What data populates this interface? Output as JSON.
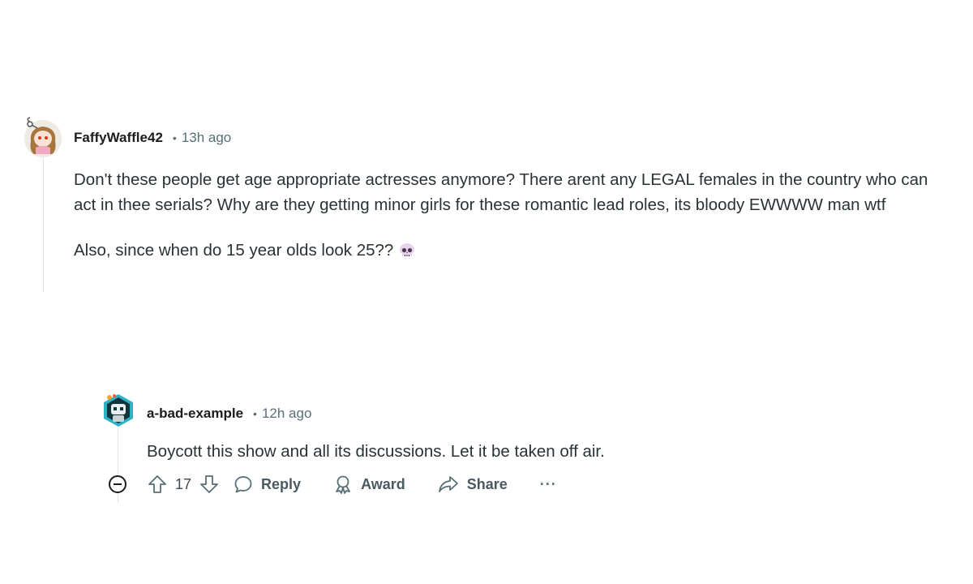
{
  "comment": {
    "username": "FaffyWaffle42",
    "separator": "•",
    "time": "13h ago",
    "paragraphs": [
      "Don't these people get age appropriate actresses anymore? There arent any LEGAL females in the country who can act in thee serials? Why are they getting minor girls for these romantic lead roles, its bloody EWWWW man wtf",
      "Also, since when do 15 year olds look 25??"
    ],
    "emoji_icon": "skull-icon"
  },
  "reply": {
    "username": "a-bad-example",
    "separator": "•",
    "time": "12h ago",
    "text": "Boycott this show and all its discussions. Let it be taken off air.",
    "actions": {
      "vote_count": "17",
      "reply_label": "Reply",
      "award_label": "Award",
      "share_label": "Share",
      "more_label": "···"
    }
  },
  "colors": {
    "meta_gray": "#576f76",
    "thread_line": "#e2e2e2",
    "text": "#2a3236"
  }
}
